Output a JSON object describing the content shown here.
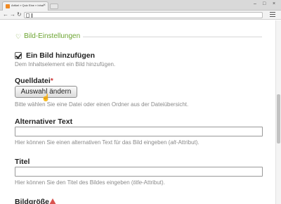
{
  "browser": {
    "tab_title": "Artikel » Quiz Eine » Inhalt",
    "tab_close": "×",
    "window_controls": [
      "–",
      "□",
      "×"
    ],
    "nav": {
      "back": "←",
      "forward": "→",
      "reload": "↻"
    },
    "address_value": ""
  },
  "section": {
    "toggle_glyph": "♡",
    "title": "Bild-Einstellungen"
  },
  "add_image": {
    "checked": true,
    "label": "Ein Bild hinzufügen",
    "help": "Dem Inhaltselement ein Bild hinzufügen."
  },
  "source_file": {
    "label": "Quelldatei",
    "required_mark": "*",
    "button_label": "Auswahl ändern",
    "help": "Bitte wählen Sie eine Datei oder einen Ordner aus der Dateiübersicht."
  },
  "alt_text": {
    "label": "Alternativer Text",
    "value": "",
    "help_before": "Hier können Sie einen alternativen Text für das Bild eingeben (",
    "help_attr": "alt",
    "help_after": "-Attribut)."
  },
  "title_field": {
    "label": "Titel",
    "value": "",
    "help_before": "Hier können Sie den Titel des Bildes eingeben (",
    "help_attr": "title",
    "help_after": "-Attribut)."
  },
  "image_size": {
    "label": "Bildgröße"
  },
  "colors": {
    "section_accent": "#6da532",
    "required": "#cc3333",
    "help_text": "#8a8a8a"
  }
}
